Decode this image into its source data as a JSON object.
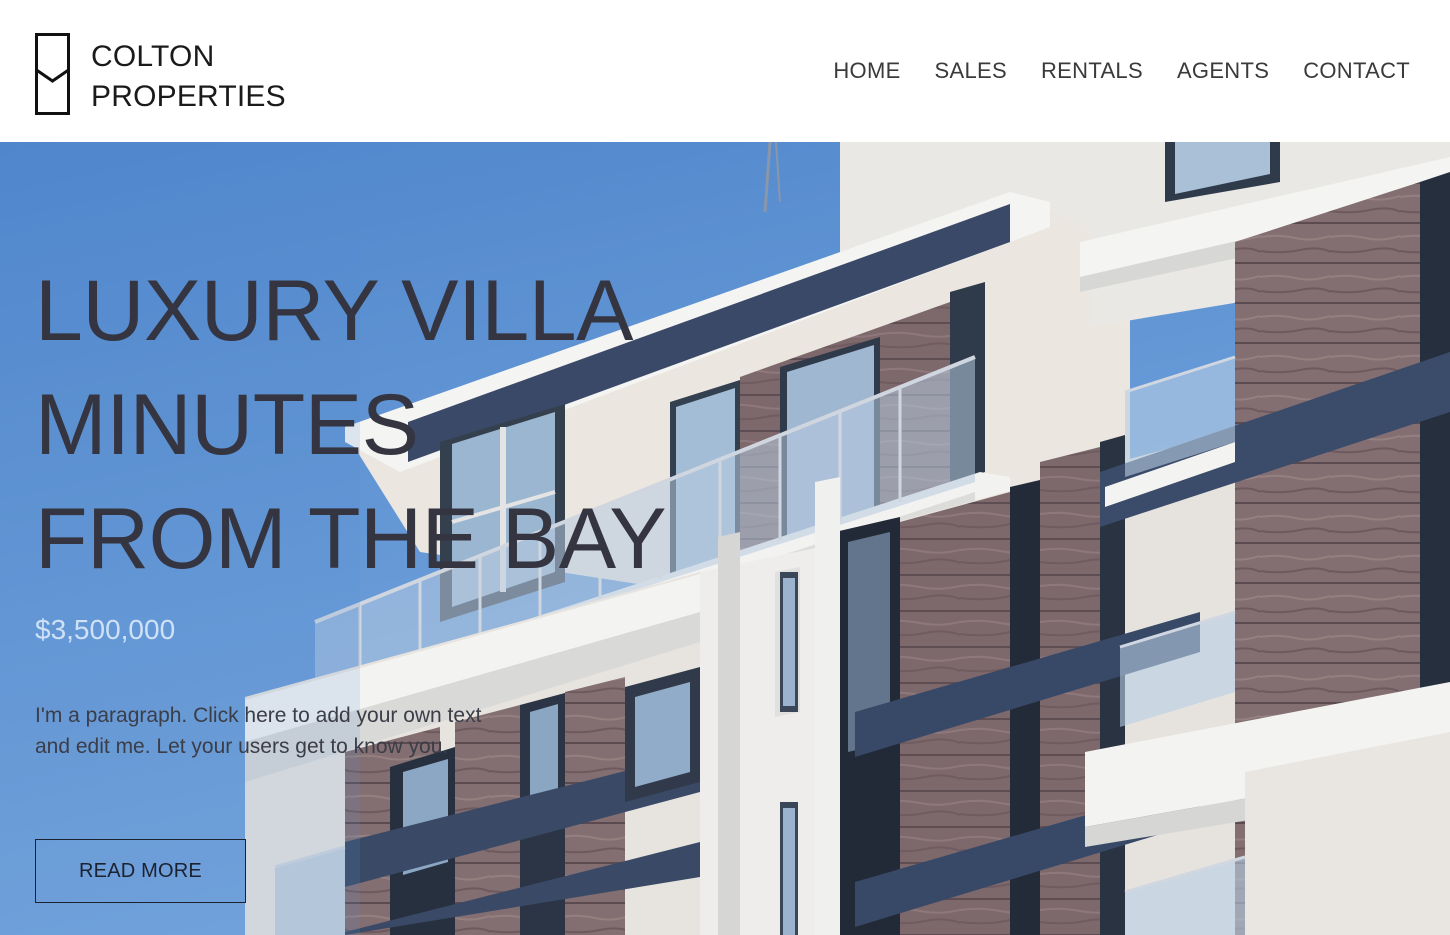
{
  "brand": {
    "line1": "COLTON",
    "line2": "PROPERTIES"
  },
  "nav": {
    "items": [
      {
        "label": "HOME"
      },
      {
        "label": "SALES"
      },
      {
        "label": "RENTALS"
      },
      {
        "label": "AGENTS"
      },
      {
        "label": "CONTACT"
      }
    ]
  },
  "hero": {
    "headline": [
      "LUXURY VILLA",
      "MINUTES",
      "FROM THE BAY"
    ],
    "price": "$3,500,000",
    "paragraph_line1": "I'm a paragraph. Click here to add your own text",
    "paragraph_line2": "and edit me. Let your users get to know you.",
    "button_label": "READ MORE",
    "image_subject": "modern apartment building facade against blue sky"
  },
  "colors": {
    "sky": "#5d8fd0",
    "headline_text": "#343541",
    "price_text": "#cfe1f6",
    "wood_panel": "#7f6a6e",
    "dark_band": "#3a4a66",
    "facade_white": "#ecebe8"
  }
}
